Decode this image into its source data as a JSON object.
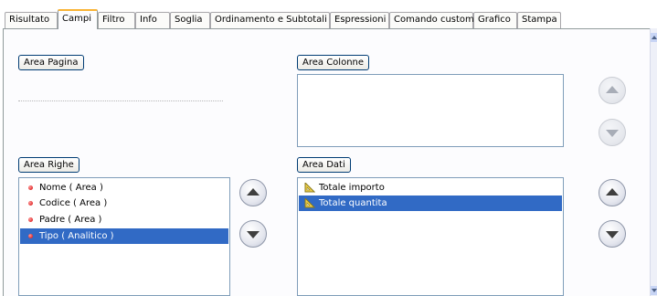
{
  "tabs": [
    {
      "label": "Risultato"
    },
    {
      "label": "Campi"
    },
    {
      "label": "Filtro"
    },
    {
      "label": "Info"
    },
    {
      "label": "Soglia"
    },
    {
      "label": "Ordinamento e Subtotali"
    },
    {
      "label": "Espressioni"
    },
    {
      "label": "Comando custom"
    },
    {
      "label": "Grafico"
    },
    {
      "label": "Stampa"
    }
  ],
  "active_tab": "Campi",
  "areas": {
    "pagina": {
      "label": "Area Pagina"
    },
    "colonne": {
      "label": "Area Colonne",
      "items": []
    },
    "righe": {
      "label": "Area Righe",
      "items": [
        {
          "label": "Nome ( Area )"
        },
        {
          "label": "Codice ( Area )"
        },
        {
          "label": "Padre ( Area )"
        },
        {
          "label": "Tipo ( Analitico )"
        }
      ],
      "selected_index": 3
    },
    "dati": {
      "label": "Area Dati",
      "items": [
        {
          "label": "Totale importo"
        },
        {
          "label": "Totale quantita"
        }
      ],
      "selected_index": 1
    }
  },
  "colors": {
    "selection": "#316ac5",
    "active_tab_accent": "#f9b335",
    "button_border": "#003c74",
    "list_border": "#7f9db9"
  },
  "icons": {
    "row_field": "red-dot-icon",
    "data_field": "ruler-triangle-icon",
    "move_up": "arrow-up-circle-icon",
    "move_down": "arrow-down-circle-icon"
  }
}
